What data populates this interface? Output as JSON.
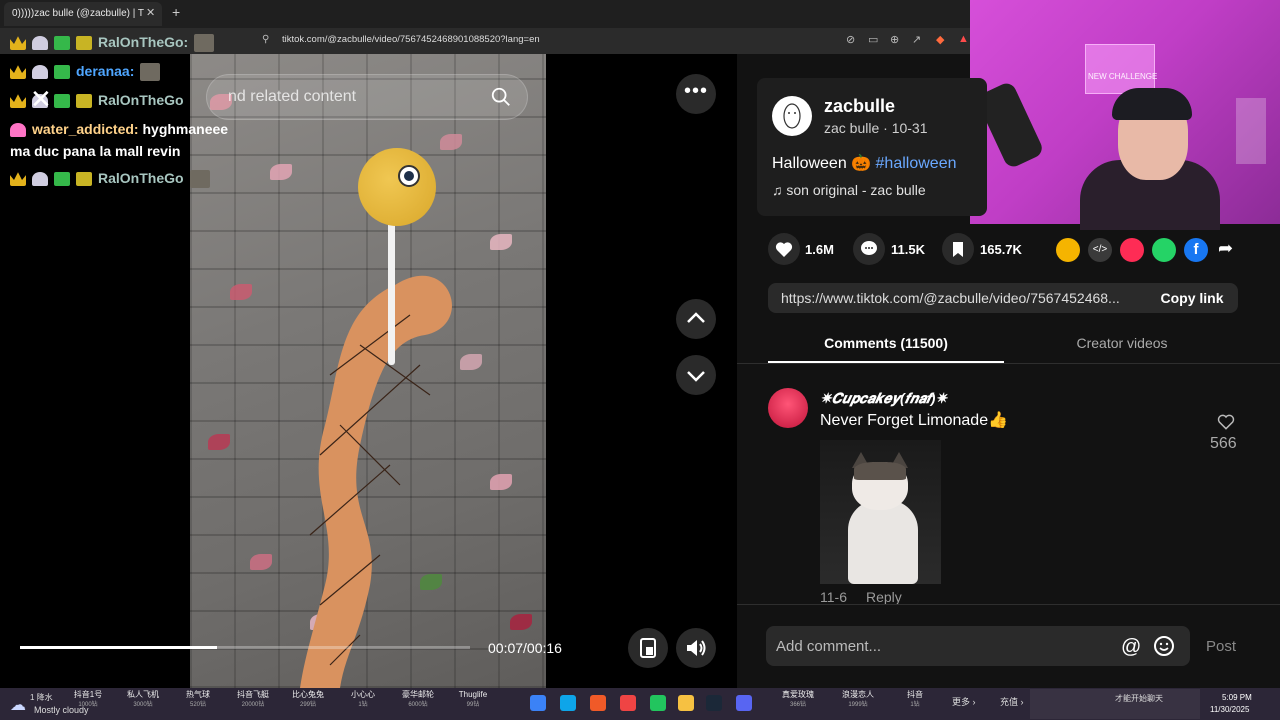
{
  "browser": {
    "tab_title": "0)))))zac bulle (@zacbulle) | T",
    "tab_close": "✕",
    "new_tab": "+",
    "url": "tiktok.com/@zacbulle/video/7567452468901088520?lang=en"
  },
  "chat": {
    "rows": [
      {
        "user": "RalOnTheGo:",
        "color": "#a8c6c0"
      },
      {
        "user": "deranaa:",
        "color": "#4fa6ff"
      },
      {
        "user": "RalOnTheGo",
        "color": "#a8c6c0"
      },
      {
        "user": "water_addicted:",
        "message": "hyghmaneee",
        "color": "#ffd28a"
      },
      {
        "message": "ma duc pana la mall revin"
      },
      {
        "user": "RalOnTheGo",
        "color": "#a8c6c0"
      }
    ]
  },
  "video": {
    "search_placeholder": "nd related content",
    "more_label": "•••",
    "time": "00:07/00:16",
    "progress": 0.4375
  },
  "webcam": {
    "poster_text": "NEW CHALLENGE"
  },
  "post": {
    "username": "zacbulle",
    "subline": "zac bulle · 10-31",
    "caption": "Halloween 🎃 ",
    "hashtag": "#halloween",
    "music": "♫  son original - zac bulle",
    "likes": "1.6M",
    "comments": "11.5K",
    "saves": "165.7K",
    "link": "https://www.tiktok.com/@zacbulle/video/7567452468...",
    "copy_link": "Copy link"
  },
  "tabs": {
    "comments": "Comments (11500)",
    "creator": "Creator videos"
  },
  "comment": {
    "name": "✷𝑪𝒖𝒑𝒄𝒂𝒌𝒆𝒚(𝒇𝒏𝒂𝒇)✷",
    "text": "Never Forget Limonade👍",
    "date": "11-6",
    "reply": "Reply",
    "likes": "566"
  },
  "compose": {
    "placeholder": "Add comment...",
    "at": "@",
    "post": "Post"
  },
  "taskbar": {
    "weather_temp": "1 降水",
    "weather_text": "Mostly cloudy",
    "items": [
      {
        "label": "抖音1号",
        "sub": "1000钻"
      },
      {
        "label": "私人飞机",
        "sub": "3000钻"
      },
      {
        "label": "热气球",
        "sub": "520钻"
      },
      {
        "label": "抖音飞艇",
        "sub": "20000钻"
      },
      {
        "label": "比心兔兔",
        "sub": "299钻"
      },
      {
        "label": "小心心",
        "sub": "1钻"
      },
      {
        "label": "豪华邮轮",
        "sub": "6000钻"
      },
      {
        "label": "Thuglife",
        "sub": "99钻"
      }
    ],
    "more": "更多 ›",
    "recharge": "充值 ›",
    "right_items": [
      {
        "label": "真爱玫瑰",
        "sub": "366钻"
      },
      {
        "label": "浪漫恋人",
        "sub": "1999钻"
      },
      {
        "label": "抖音",
        "sub": "1钻"
      }
    ],
    "tray_text": "才能开始聊天",
    "clock_time": "5:09 PM",
    "clock_date": "11/30/2025"
  },
  "colors": {
    "accent_link": "#6aa8ff",
    "webcam_bg": "#c03ec6"
  }
}
